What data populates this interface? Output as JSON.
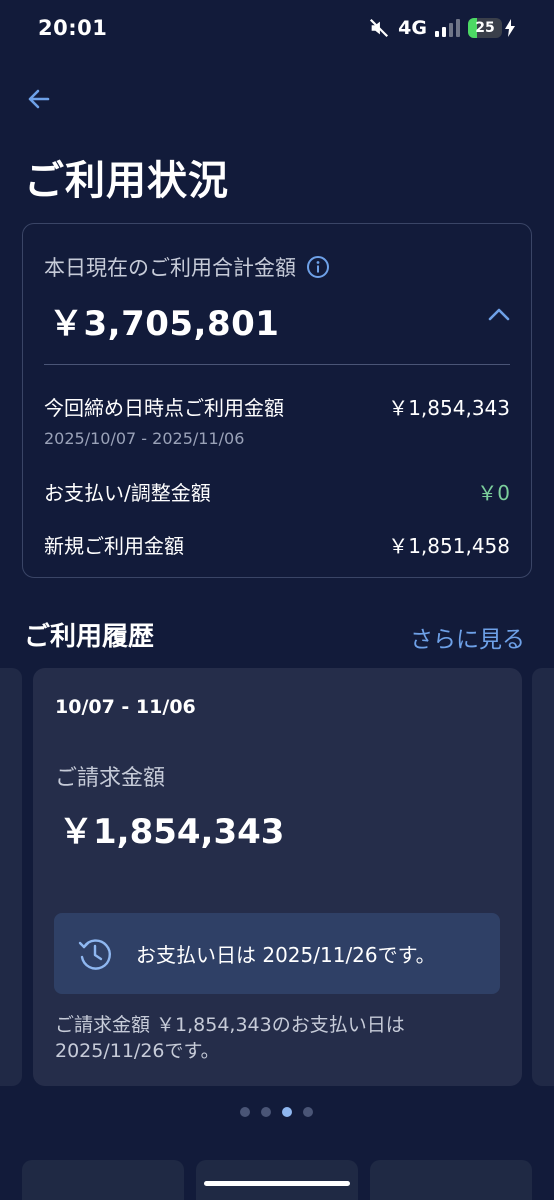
{
  "status_bar": {
    "time": "20:01",
    "network": "4G",
    "battery_level": 25,
    "battery_label": "25",
    "icons": [
      "mute-icon",
      "signal-icon",
      "battery-icon",
      "charging-bolt-icon"
    ]
  },
  "header": {
    "back_icon": "arrow-left-icon",
    "title": "ご利用状況"
  },
  "summary": {
    "label": "本日現在のご利用合計金額",
    "info_icon": "info-icon",
    "total": "￥3,705,801",
    "collapse_icon": "chevron-up-icon",
    "rows": [
      {
        "label": "今回締め日時点ご利用金額",
        "value": "￥1,854,343",
        "sub": "2025/10/07 - 2025/11/06"
      },
      {
        "label": "お支払い/調整金額",
        "value": "￥0"
      },
      {
        "label": "新規ご利用金額",
        "value": "￥1,851,458"
      }
    ]
  },
  "history": {
    "title": "ご利用履歴",
    "see_more": "さらに見る",
    "card": {
      "period": "10/07 - 11/06",
      "billing_label": "ご請求金額",
      "billing_amount": "￥1,854,343",
      "due_icon": "clock-icon",
      "due_text": "お支払い日は 2025/11/26です。",
      "note": "ご請求金額 ￥1,854,343のお支払い日は 2025/11/26です。"
    },
    "pagination": {
      "count": 4,
      "active_index": 2
    }
  },
  "colors": {
    "background": "#121b3a",
    "card": "#252d4a",
    "accent": "#6ea1e8",
    "positive": "#7ccf9c",
    "due_box": "#2f4066"
  }
}
